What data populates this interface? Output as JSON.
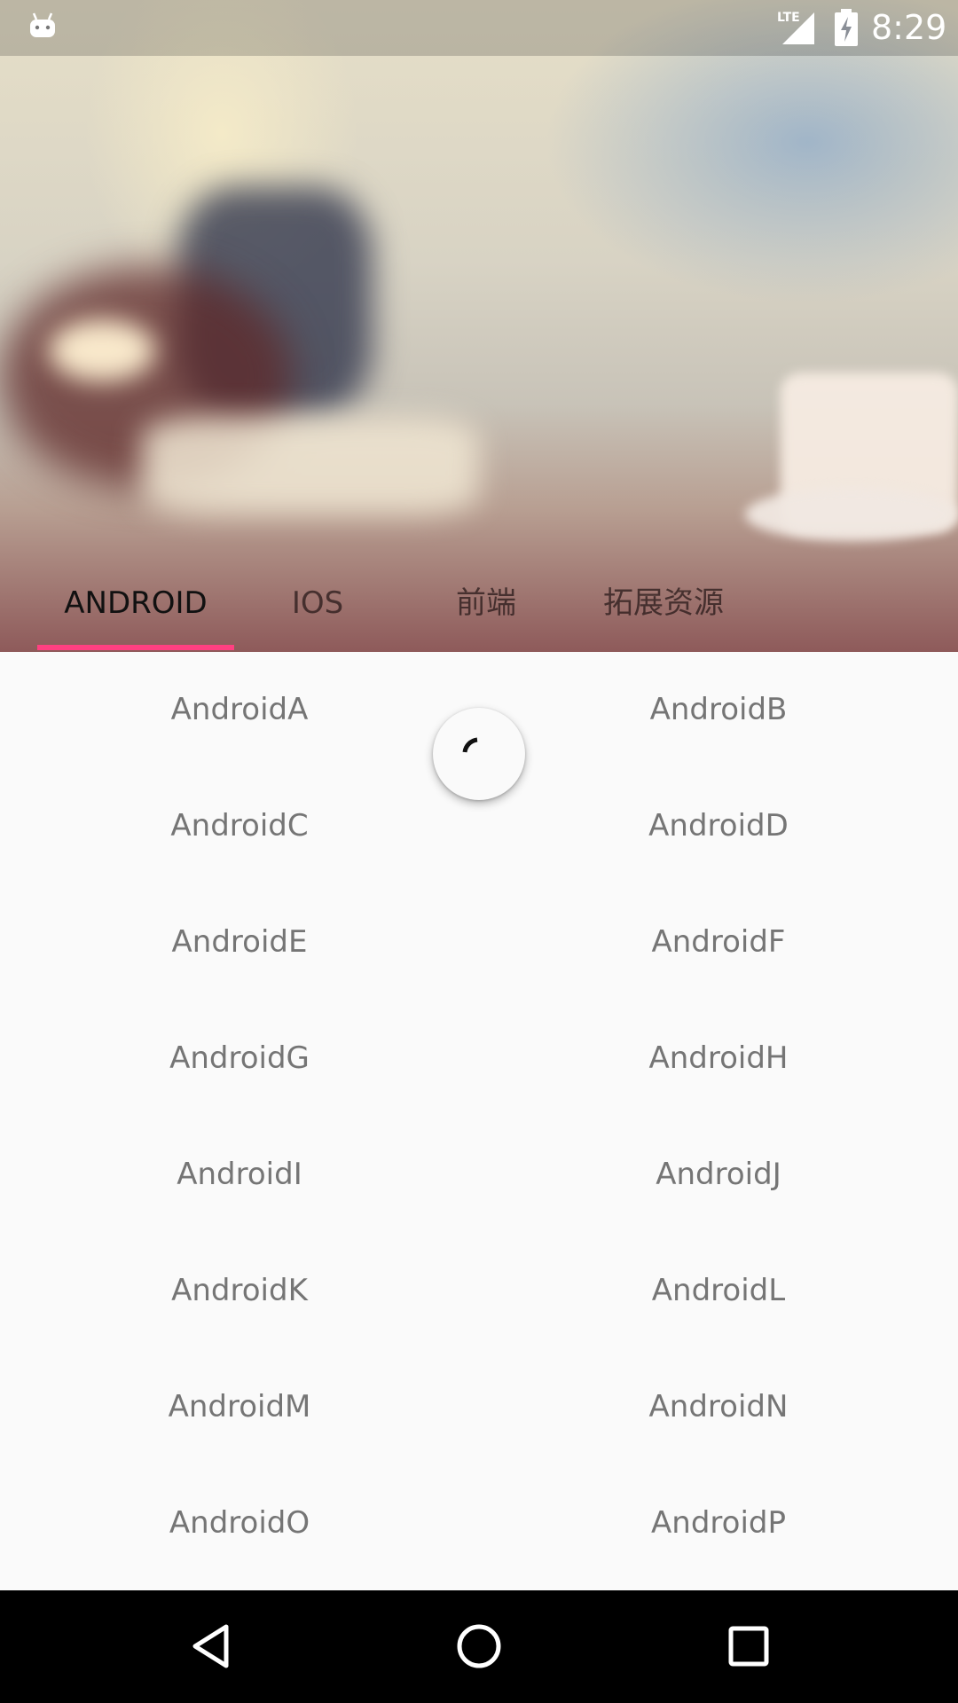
{
  "status_bar": {
    "time": "8:29",
    "network": "LTE",
    "icons": [
      "android-debug-icon",
      "lte-signal-icon",
      "battery-charging-icon"
    ]
  },
  "tabs": [
    {
      "label": "ANDROID",
      "selected": true
    },
    {
      "label": "IOS",
      "selected": false
    },
    {
      "label": "前端",
      "selected": false
    },
    {
      "label": "拓展资源",
      "selected": false
    }
  ],
  "grid_items": [
    "AndroidA",
    "AndroidB",
    "AndroidC",
    "AndroidD",
    "AndroidE",
    "AndroidF",
    "AndroidG",
    "AndroidH",
    "AndroidI",
    "AndroidJ",
    "AndroidK",
    "AndroidL",
    "AndroidM",
    "AndroidN",
    "AndroidO",
    "AndroidP"
  ],
  "colors": {
    "tab_indicator": "#ff4081",
    "item_text": "#757575",
    "background": "#fafafa"
  },
  "nav_bar": {
    "icons": [
      "back-icon",
      "home-icon",
      "recents-icon"
    ]
  }
}
